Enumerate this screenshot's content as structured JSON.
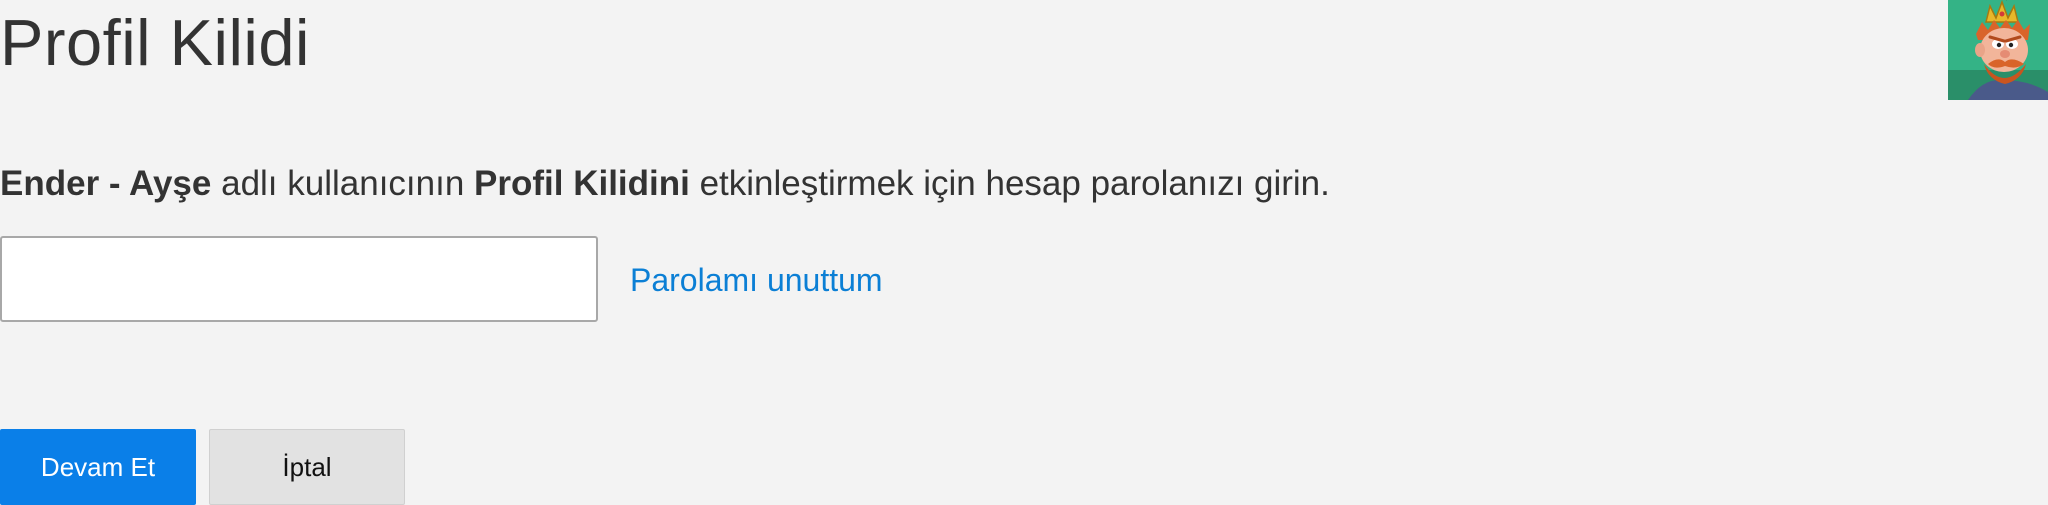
{
  "page": {
    "title": "Profil Kilidi"
  },
  "instructions": {
    "profile_name": "Ender - Ayşe",
    "text_part1": " adlı kullanıcının ",
    "feature_name": "Profil Kilidini",
    "text_part2": " etkinleştirmek için hesap parolanızı girin."
  },
  "password_field": {
    "value": "",
    "placeholder": ""
  },
  "forgot_password_link": "Parolamı unuttum",
  "buttons": {
    "continue_label": "Devam Et",
    "cancel_label": "İptal"
  },
  "avatar": {
    "icon": "profile-avatar-king-cartoon"
  },
  "colors": {
    "background": "#f3f3f3",
    "primary_button": "#0a7fe8",
    "link": "#0b7fd5",
    "secondary_button": "#e2e2e2"
  }
}
